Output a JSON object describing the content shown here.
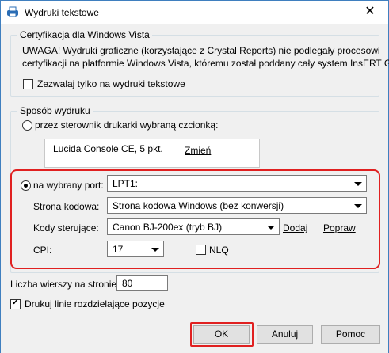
{
  "window": {
    "title": "Wydruki tekstowe",
    "close_glyph": "✕"
  },
  "vista_group": {
    "legend": "Certyfikacja dla Windows Vista",
    "warning_line1": "UWAGA! Wydruki graficzne (korzystające z Crystal Reports) nie podlegały procesowi",
    "warning_line2": "certyfikacji na platformie Windows Vista, któremu został poddany cały system InsERT GT.",
    "checkbox_label": "Zezwalaj tylko na wydruki tekstowe",
    "checkbox_checked": false
  },
  "print_group": {
    "legend": "Sposób wydruku",
    "radio_driver_label": "przez sterownik drukarki wybraną czcionką:",
    "font_value": "Lucida Console CE, 5 pkt.",
    "change_link": "Zmień",
    "radio_port_label": "na wybrany port:",
    "port_value": "LPT1:",
    "codepage_label": "Strona kodowa:",
    "codepage_value": "Strona kodowa Windows (bez konwersji)",
    "control_codes_label": "Kody sterujące:",
    "control_codes_value": "Canon BJ-200ex (tryb BJ)",
    "add_link": "Dodaj",
    "edit_link": "Popraw",
    "cpi_label": "CPI:",
    "cpi_value": "17",
    "nlq_label": "NLQ",
    "nlq_checked": false
  },
  "lines_per_page_label": "Liczba wierszy na stronie:",
  "lines_per_page_value": "80",
  "separator_label": "Drukuj linie rozdzielające pozycje",
  "separator_checked": true,
  "buttons": {
    "ok": "OK",
    "cancel": "Anuluj",
    "help": "Pomoc"
  },
  "colors": {
    "highlight": "#e02020",
    "window_border": "#3f7fbf"
  }
}
